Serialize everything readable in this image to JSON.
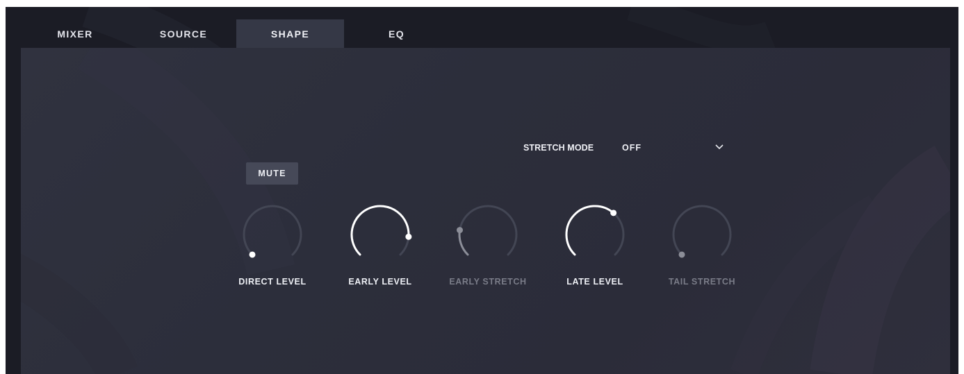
{
  "tabs": [
    {
      "label": "MIXER",
      "active": false
    },
    {
      "label": "SOURCE",
      "active": false
    },
    {
      "label": "SHAPE",
      "active": true
    },
    {
      "label": "EQ",
      "active": false
    }
  ],
  "stretch_mode": {
    "label": "STRETCH MODE",
    "value": "OFF",
    "icon": "chevron-down-icon"
  },
  "mute": {
    "label": "MUTE"
  },
  "knobs": [
    {
      "label": "DIRECT LEVEL",
      "value": 0.0,
      "enabled": true
    },
    {
      "label": "EARLY LEVEL",
      "value": 0.85,
      "enabled": true
    },
    {
      "label": "EARLY STRETCH",
      "value": 0.2,
      "enabled": false
    },
    {
      "label": "LATE LEVEL",
      "value": 0.65,
      "enabled": true
    },
    {
      "label": "TAIL STRETCH",
      "value": 0.0,
      "enabled": false
    }
  ],
  "colors": {
    "background": "#1b1c25",
    "panel": "#2d2f3c",
    "active_tab": "#353846",
    "knob_active": "#ffffff",
    "knob_disabled": "#8c8e98",
    "knob_track": "#434654"
  }
}
